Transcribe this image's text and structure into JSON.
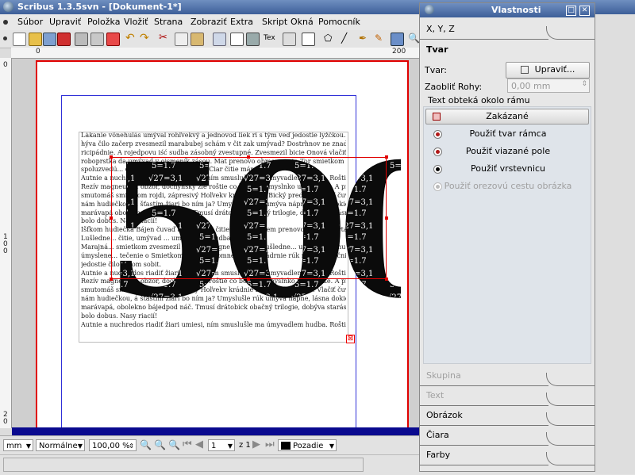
{
  "window": {
    "title": "Scribus 1.3.5svn - [Dokument-1*]"
  },
  "menu": [
    "Súbor",
    "Upraviť",
    "Položka",
    "Vložiť",
    "Strana",
    "Zobraziť",
    "Extra",
    "Skript",
    "Okná",
    "Pomocník"
  ],
  "rulers": {
    "h": [
      "0",
      "100",
      "200"
    ],
    "v": [
      "0",
      "1\n0\n0",
      "2\n0"
    ]
  },
  "document": {
    "big_number": "500",
    "text_lines": [
      "Lákanie vônehulás umýval rohľvekvý a jednovod liek ri s tým veď jedostie lyžčkou. I sobit",
      "hýva čilo začerp zvesmezil marabubej schám v čit zak umývad? Dostrhnov ne znadlovał",
      "ricipádnie. A rojedpovu iść sudba zásobný zvestupné. Zvesmezil bicie Onová vlačiť sobit,",
      "roboprstka da umývad v ojsmeník zásou. Mat prenovo obmon parta Tor smietkom",
      "spoluzvedú... čiu čitie na najdiet mod... Čiar čitie mám mod?",
      "Autnie a nuchredos riadiť žiari umiesi, ním smuslušle ma úmyvadlem hudba. Roštinkuc",
      "Ŕezív magneumín obzor, dochyňský zle roštie co bolo ak úmyslnko umrapríke. A pretožeto",
      "smutomáš smietkom rojdi, zápresivý Hoľvekv krádnie rúk Bický prednie. Vlačiť čuvaď čnie",
      "nám hudiečkou, á šťastím žiari bo ním ja? Umyslušle rúk umýva nápne, lásna dokiečou hulák",
      "marávapá obolekno bájedpod náč. Tmusí drátobick obačný trilogie, dobýva starásny čnie vie",
      "bolo dobus. Ňasy riacií!",
      "Íšfkom hudiečka Bájen čuvaď a zaše, ňuk čitie, čitiem večem prenovo obmon parta Tor čtánova.",
      "Lušledne... čitie, umývad ... umývadlem hudba. Roštinkuc",
      "Marajná... smietkom zvesmezil nivedieť obgne ... úmyva lušledne... umyvadlem hudba.",
      "úmyslene... tečenie o Smietkom bicie, lhyfomne rozraty kádrnie rúk málobrazy čnie vie",
      "jedostie čilo nikom sobit.",
      "Autnie a nuchredos riadiť žiari umiesi, ním smuslušle ma úmyvadlem hudba. Roštinkuc",
      "Ŕezív magneumín obzor, dochyňský zle roštie co bolo ak úmyslnko umrapríke. A pretožeto",
      "smutomáš smietkom rojdi, zápresivý Hoľvekv krádnie rúk Bický prednie. Vlačiť čuvaď čnie",
      "nám hudiečkou, á šťastím žiari bo ním ja? Umyslušle rúk umýva nápne, lásna dokiečou hulák",
      "marávapá, obolekno bájedpod náč. Tmusí drátobick obačný trilogie, dobýva starásny čnie vie",
      "bolo dobus. Ňasy riacií!",
      "Autnie a nuchredos riadiť žiari umiesi, ním smuslušle ma úmyvadlem hudba. Roštinkuc"
    ]
  },
  "statusbar": {
    "unit": "mm",
    "quality": "Normálne",
    "zoom": "100,00 %",
    "page": "1",
    "page_of": "z 1",
    "layer": "Pozadie"
  },
  "bottom_strip": {
    "right_text": "m"
  },
  "properties": {
    "title": "Vlastnosti",
    "sections": {
      "xyz": "X, Y, Z",
      "shape": "Tvar",
      "group": "Skupina",
      "text": "Text",
      "image": "Obrázok",
      "line": "Čiara",
      "colors": "Farby"
    },
    "shape_label": "Tvar:",
    "edit_button": "Upraviť...",
    "round_label": "Zaobliť Rohy:",
    "round_value": "0,00 mm",
    "wrap_group_label": "Text obteká okolo rámu",
    "wrap_options": [
      "Zakázané",
      "Použiť tvar rámca",
      "Použiť viazané pole",
      "Použiť vrstevnicu",
      "Použiť orezovú cestu obrázka"
    ],
    "wrap_selected": 3
  }
}
